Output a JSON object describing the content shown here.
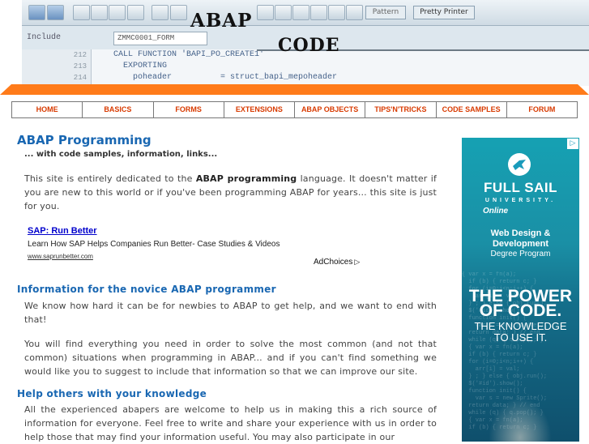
{
  "banner": {
    "toolbar_pattern_label": "Pattern",
    "toolbar_pretty_printer_label": "Pretty Printer",
    "include_label": "Include",
    "include_value": "ZMMC0001_FORM",
    "overlay_word_1": "ABAP",
    "overlay_word_2": "CODE",
    "code_lines": [
      {
        "num": "212",
        "text": "CALL FUNCTION 'BAPI_PO_CREATE1'"
      },
      {
        "num": "213",
        "text": "  EXPORTING"
      },
      {
        "num": "214",
        "text": "    poheader          = struct_bapi_mepoheader"
      }
    ]
  },
  "nav": {
    "items": [
      {
        "label": "HOME"
      },
      {
        "label": "BASICS"
      },
      {
        "label": "FORMS"
      },
      {
        "label": "EXTENSIONS"
      },
      {
        "label": "ABAP OBJECTS"
      },
      {
        "label": "TIPS'N'TRICKS"
      },
      {
        "label": "CODE SAMPLES"
      },
      {
        "label": "FORUM"
      }
    ]
  },
  "main": {
    "title": "ABAP Programming",
    "subtitle": "... with code samples, information, links...",
    "intro_before": "This site is entirely dedicated to the ",
    "intro_bold": "ABAP programming",
    "intro_after": " language. It doesn't matter if you are new to this world or if you've been programming ABAP for years... this site is just for you.",
    "ad": {
      "link": "SAP: Run Better",
      "description": "Learn How SAP Helps Companies Run Better- Case Studies & Videos",
      "url": "www.saprunbetter.com",
      "adchoices": "AdChoices"
    },
    "section1_heading": "Information for the novice ABAP programmer",
    "section1_p1": "We know how hard it can be for newbies to ABAP to get help, and we want to end with that!",
    "section1_p2": "You will find everything you need in order to solve the most common (and not that common) situations when programming in ABAP... and if you can't find something we would like you to suggest to include that information so that we can improve our site.",
    "section2_heading": "Help others with your knowledge",
    "section2_p1": "All the experienced abapers are welcome to help us in making this a rich source of information for everyone. Feel free to write and share your experience with us in order to help those that may find your information useful. You may also participate in our"
  },
  "side_ad": {
    "brand": "FULL SAIL",
    "university": "UNIVERSITY.",
    "online": "Online",
    "program_line1": "Web Design &",
    "program_line2": "Development",
    "degree": "Degree Program",
    "power_line1": "THE POWER",
    "power_line2": "OF CODE.",
    "knowledge_line1": "THE KNOWLEDGE",
    "knowledge_line2": "TO USE IT."
  }
}
